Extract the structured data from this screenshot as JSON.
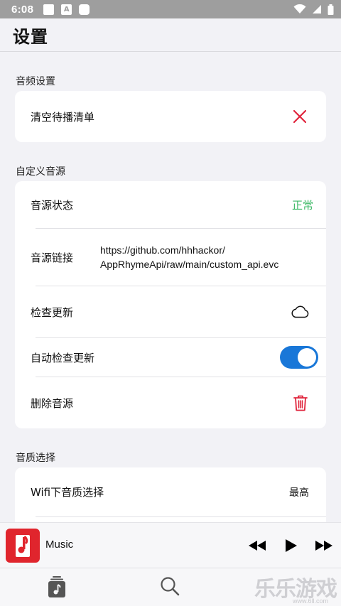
{
  "status": {
    "time": "6:08",
    "notif_letter": "A"
  },
  "header": {
    "title": "设置"
  },
  "audio": {
    "section_title": "音频设置",
    "clear_queue_label": "清空待播清单"
  },
  "custom_source": {
    "section_title": "自定义音源",
    "status_label": "音源状态",
    "status_value": "正常",
    "link_label": "音源链接",
    "link_line1": "https://github.com/hhhackor/",
    "link_line2": "AppRhymeApi/raw/main/custom_api.evc",
    "check_update_label": "检查更新",
    "auto_check_label": "自动检查更新",
    "auto_check_enabled": true,
    "delete_label": "删除音源"
  },
  "quality": {
    "section_title": "音质选择",
    "wifi_label": "Wifi下音质选择",
    "wifi_value": "最高"
  },
  "player": {
    "title": "Music"
  },
  "watermark": {
    "text": "乐乐游戏",
    "url": "www.6ll.com"
  },
  "colors": {
    "accent": "#1977d8",
    "danger": "#e0253d",
    "ok": "#3cb865"
  }
}
